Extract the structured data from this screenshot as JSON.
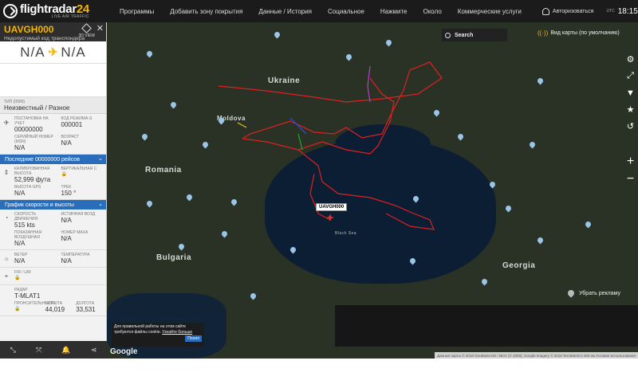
{
  "app": {
    "logo": "flightradar",
    "logo_suffix": "24",
    "logo_tagline": "LIVE AIR TRAFFIC"
  },
  "nav": {
    "items": [
      "Программы",
      "Добавить зону покрытия",
      "Данные / История",
      "Социальное",
      "Нажмите",
      "Около",
      "Коммерческие услуги"
    ],
    "login": "Авторизоваться",
    "utc_label": "UTC",
    "time": "18:15"
  },
  "flight": {
    "callsign": "UAVGH000",
    "transponder_note": "Недопустимый код транспондера",
    "view_label": "3D VIEW",
    "origin": "N/A",
    "destination": "N/A",
    "type_label": "ТИП",
    "type_code": "(0000)",
    "type_value": "Неизвестный / Разное",
    "reg_label": "ПОСТАНОВКА НА УЧЕТ",
    "reg_value": "00000000",
    "modes_label": "КОД РЕЖИМА-S",
    "modes_value": "000001",
    "serial_label": "СЕРИЙНЫЙ НОМЕР (MSN)",
    "serial_value": "N/A",
    "age_label": "ВОЗРАСТ",
    "age_value": "N/A",
    "recent_bar": "Последние 00000000 рейсов",
    "calib_alt_label": "КАЛИБРОВАННАЯ ВЫСОТА",
    "calib_alt_value": "52,999 фута",
    "vert_speed_label": "ВЕРТИКАЛЬНАЯ С",
    "gps_alt_label": "ВЫСОТА GPS",
    "gps_alt_value": "N/A",
    "track_label": "ТРЕК",
    "track_value": "150 °",
    "speed_bar": "График скорости и высоты",
    "ground_speed_label": "СКОРОСТЬ ДВИЖЕНИЯ",
    "ground_speed_value": "515 kts",
    "true_speed_label": "ИСТИННАЯ ВОЗД",
    "true_speed_value": "N/A",
    "ias_label": "ПОКАЗАННАЯ ВОЗДУШНАЯ",
    "ias_value": "N/A",
    "mach_label": "НОМЕР МАХА",
    "mach_value": "N/A",
    "wind_label": "ВЕТЕР",
    "wind_value": "N/A",
    "temp_label": "ТЕМПЕРАТУРА",
    "temp_value": "N/A",
    "fir_label": "FIR / UIR",
    "radar_label": "РАДАР",
    "radar_value": "T-MLAT1",
    "lat_label": "ШИРОТА",
    "lat_value": "44,019",
    "lon_label": "ДОЛГОТА",
    "lon_value": "33,531",
    "prolong_label": "ПРОНСИТЕЛЬНОСТЬ"
  },
  "map": {
    "search_label": "Search",
    "map_view_label": "Вид карты (по умолчанию)",
    "aircraft_tag": "UAVGH000",
    "country_labels": [
      "Ukraine",
      "Moldova",
      "Romania",
      "Bulgaria",
      "Georgia"
    ],
    "sea_label": "Black Sea",
    "remove_ads": "Убрать рекламу",
    "google": "Google",
    "attribution": "Данные карты © 2018 GeoBasis-DE / BKG (© 2009), Google Imagery © 2018 TerraMetrics  500 км  Условия использования"
  },
  "cookie": {
    "text": "Для правильной работы на этом сайте требуются файлы cookie.",
    "link": "Узнайте больше",
    "button": "Понял"
  },
  "icons": {
    "side_tools": [
      "settings-icon",
      "fullscreen-icon",
      "filter-icon",
      "star-icon",
      "history-icon"
    ],
    "bottom": [
      "route-icon",
      "expand-icon",
      "alert-icon",
      "share-icon"
    ]
  }
}
